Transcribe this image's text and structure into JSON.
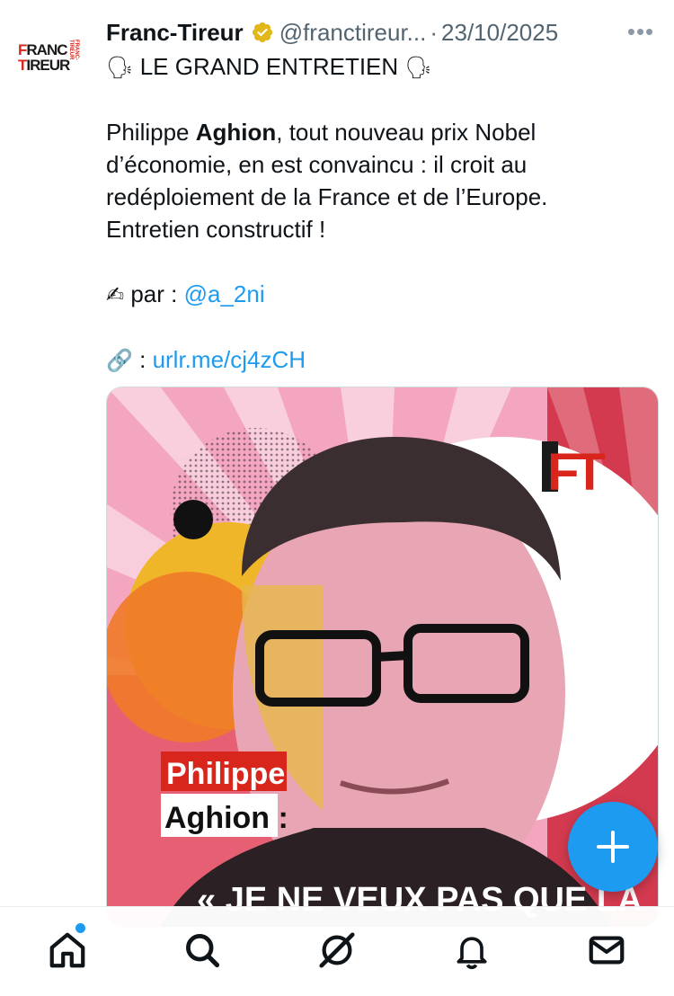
{
  "tweet": {
    "author_name": "Franc-Tireur",
    "handle": "@franctireur...",
    "separator": "·",
    "date": "23/10/2025",
    "more": "•••",
    "avatar": {
      "line1a": "F",
      "line1b": "RANC",
      "line2a": "T",
      "line2b": "IREUR",
      "side": "FRANC-TIREUR"
    },
    "headline_emoji": "🗣",
    "headline": " LE GRAND ENTRETIEN ",
    "body_pre": "Philippe ",
    "body_bold": "Aghion",
    "body_post": ", tout nouveau prix Nobel d’économie, en est convaincu : il croit au redéploiement de la France et de l’Europe. Entretien constructif !",
    "author_emoji": "✍",
    "author_prefix": " par : ",
    "author_mention": "@a_2ni",
    "link_emoji": "🔗",
    "link_prefix": " : ",
    "link_text": "urlr.me/cj4zCH"
  },
  "media": {
    "logo": "FT",
    "name_line1": "Philippe",
    "name_line2": "Aghion :",
    "quote": "« JE NE VEUX PAS QUE LA"
  },
  "colors": {
    "accent": "#1d9bf0",
    "brand_red": "#d9261c",
    "verified_gold": "#e2b719",
    "pink_bg": "#f4a6c1"
  },
  "fab": {
    "icon": "plus-icon"
  },
  "tabbar": [
    {
      "name": "home",
      "icon": "home-icon",
      "has_badge": true
    },
    {
      "name": "search",
      "icon": "search-icon"
    },
    {
      "name": "grok",
      "icon": "grok-icon"
    },
    {
      "name": "notifications",
      "icon": "bell-icon"
    },
    {
      "name": "messages",
      "icon": "mail-icon"
    }
  ]
}
